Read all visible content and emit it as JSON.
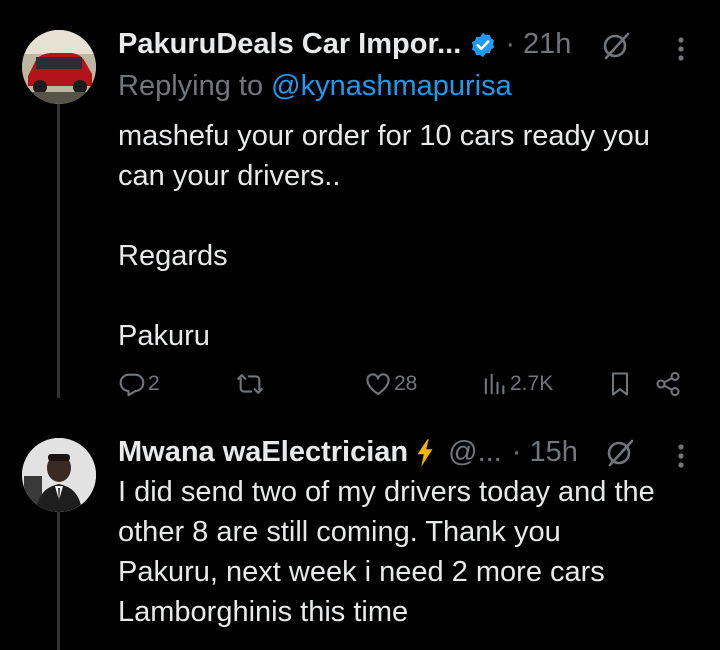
{
  "tweet1": {
    "author": "PakuruDeals Car Impor...",
    "time": "· 21h",
    "replying_prefix": "Replying to ",
    "replying_handle": "@kynashmapurisa",
    "line1": "mashefu your order for 10 cars ready you",
    "line2": "can your drivers..",
    "line3": "Regards",
    "line4": "Pakuru",
    "replies": "2",
    "likes": "28",
    "views": "2.7K"
  },
  "tweet2": {
    "author": "Mwana waElectrician",
    "handle": "@...",
    "time": "· 15h",
    "line1": "I did send two of my drivers today and the",
    "line2": "other 8 are still coming. Thank you",
    "line3": "Pakuru, next week i need 2 more cars",
    "line4": "Lamborghinis this time"
  },
  "colors": {
    "background": "#000000",
    "text": "#e7e9ea",
    "muted": "#71767b",
    "link": "#1d9bf0",
    "verified": "#1d9bf0",
    "emoji_bolt": "#f4b400"
  }
}
